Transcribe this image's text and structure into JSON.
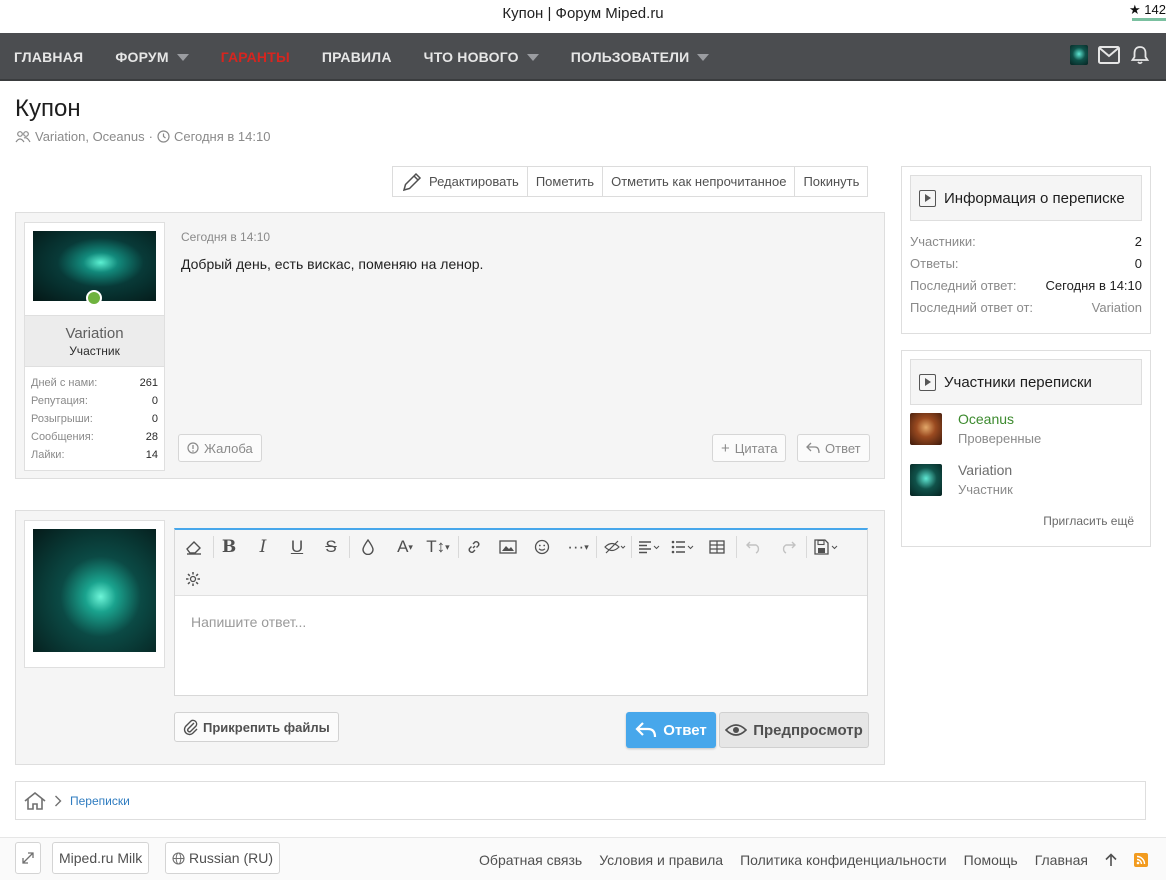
{
  "window": {
    "title": "Купон | Форум Miped.ru",
    "top_right": "★ 142"
  },
  "nav": {
    "items": [
      {
        "label": "ГЛАВНАЯ",
        "caret": false
      },
      {
        "label": "ФОРУМ",
        "caret": true
      },
      {
        "label": "ГАРАНТЫ",
        "caret": false,
        "color": "#d6251f"
      },
      {
        "label": "ПРАВИЛА",
        "caret": false
      },
      {
        "label": "ЧТО НОВОГО",
        "caret": true
      },
      {
        "label": "ПОЛЬЗОВАТЕЛИ",
        "caret": true
      }
    ],
    "icons": [
      "avatar",
      "envelope-icon",
      "bell-icon"
    ]
  },
  "page": {
    "title": "Купон",
    "participants": "Variation, Oceanus",
    "separator": "·",
    "time": "Сегодня в 14:10"
  },
  "actions": [
    "Редактировать",
    "Пометить",
    "Отметить как непрочитанное",
    "Покинуть"
  ],
  "message": {
    "user": {
      "name": "Variation",
      "role": "Участник",
      "stats": [
        {
          "label": "Дней с нами:",
          "value": "261"
        },
        {
          "label": "Репутация:",
          "value": "0"
        },
        {
          "label": "Розыгрыши:",
          "value": "0"
        },
        {
          "label": "Сообщения:",
          "value": "28"
        },
        {
          "label": "Лайки:",
          "value": "14"
        }
      ]
    },
    "time": "Сегодня в 14:10",
    "text": "Добрый день, есть вискас, поменяю на ленор.",
    "report": "Жалоба",
    "quote": "Цитата",
    "reply": "Ответ"
  },
  "reply_box": {
    "placeholder": "Напишите ответ...",
    "attach": "Прикрепить файлы",
    "send": "Ответ",
    "preview": "Предпросмотр"
  },
  "sidebar": {
    "info": {
      "title": "Информация о переписке",
      "rows": [
        {
          "label": "Участники:",
          "value": "2"
        },
        {
          "label": "Ответы:",
          "value": "0"
        },
        {
          "label": "Последний ответ:",
          "value": "Сегодня в 14:10"
        },
        {
          "label": "Последний ответ от:",
          "value": "Variation"
        }
      ]
    },
    "participants": {
      "title": "Участники переписки",
      "list": [
        {
          "name": "Oceanus",
          "role": "Проверенные",
          "color": "#3c8a2e"
        },
        {
          "name": "Variation",
          "role": "Участник",
          "color": "#6e6e6e"
        }
      ],
      "invite": "Пригласить ещё"
    }
  },
  "breadcrumb": {
    "link": "Переписки"
  },
  "footer": {
    "style": "Miped.ru Milk",
    "language": "Russian (RU)",
    "links": [
      "Обратная связь",
      "Условия и правила",
      "Политика конфиденциальности",
      "Помощь",
      "Главная"
    ]
  },
  "colors": {
    "nav_bg": "#4b4d50",
    "accent": "#47a7eb",
    "online": "#6fb33f"
  }
}
